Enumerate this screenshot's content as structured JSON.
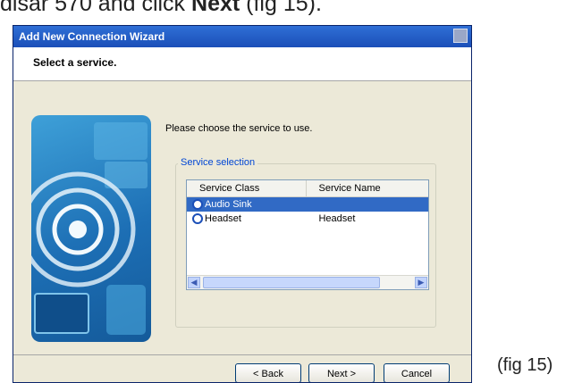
{
  "document": {
    "top_text_prefix": "disar 570 and click ",
    "top_text_bold": "Next",
    "top_text_suffix": " (fig 15).",
    "fig_caption": "(fig 15)"
  },
  "wizard": {
    "title": "Add New Connection Wizard",
    "header": "Select a service.",
    "instruction": "Please choose the service to use.",
    "group_label": "Service selection",
    "columns": [
      "Service Class",
      "Service Name"
    ],
    "rows": [
      {
        "service_class": "Audio Sink",
        "service_name": "",
        "icon": "bluetooth-audio-icon",
        "selected": true
      },
      {
        "service_class": "Headset",
        "service_name": "Headset",
        "icon": "bluetooth-headset-icon",
        "selected": false
      }
    ],
    "buttons": {
      "back": "< Back",
      "next": "Next >",
      "cancel": "Cancel"
    },
    "colors": {
      "titlebar": "#1b4fb8",
      "selection": "#316ac5",
      "group_label": "#0046d5",
      "dialog_bg": "#ece9d8"
    }
  }
}
